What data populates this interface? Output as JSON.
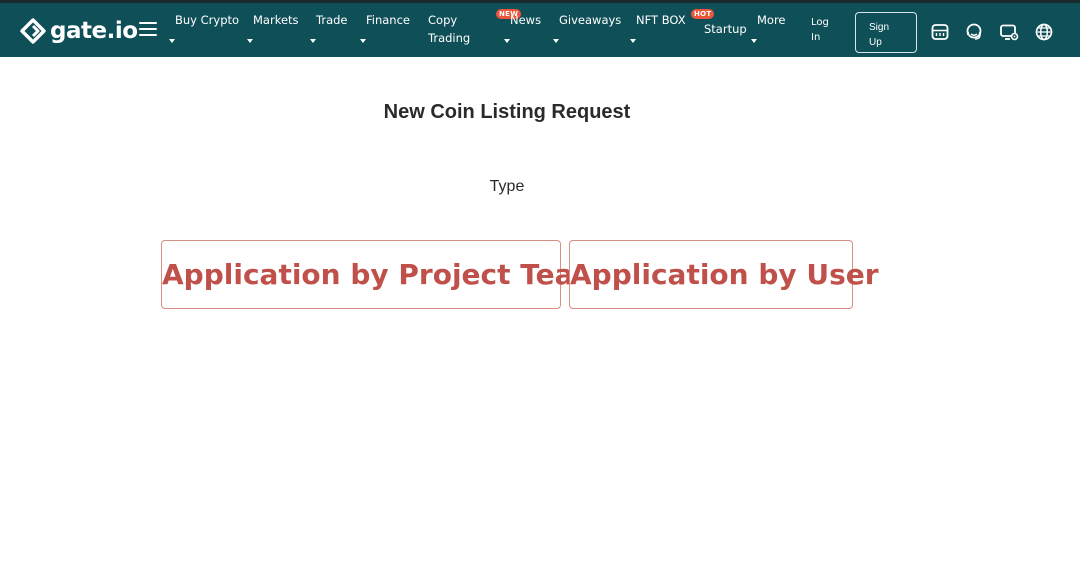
{
  "header": {
    "logo_text": "gate.io",
    "nav": [
      {
        "line1": "Buy Crypto",
        "line2": ""
      },
      {
        "line1": "Markets",
        "line2": ""
      },
      {
        "line1": "Trade",
        "line2": ""
      },
      {
        "line1": "Finance",
        "line2": ""
      },
      {
        "line1": "Copy",
        "line2": "Trading"
      },
      {
        "line1": "News",
        "line2": ""
      },
      {
        "line1": "Giveaways",
        "line2": ""
      },
      {
        "line1": "NFT BOX",
        "line2": ""
      },
      {
        "line1": "Startup",
        "line2": ""
      },
      {
        "line1": "More",
        "line2": ""
      }
    ],
    "badges": {
      "new": "NEW",
      "hot": "HOT"
    },
    "login": {
      "line1": "Log",
      "line2": "In"
    },
    "signup": {
      "line1": "Sign",
      "line2": "Up"
    },
    "colors": {
      "bar": "#0f4f57",
      "badge": "#e9563b"
    }
  },
  "main": {
    "title": "New Coin Listing Request",
    "type_label": "Type",
    "options": [
      {
        "label": "Application by Project Team"
      },
      {
        "label": "Application by User"
      }
    ],
    "colors": {
      "option_text": "#c0504a",
      "option_border": "#d98f83"
    }
  }
}
